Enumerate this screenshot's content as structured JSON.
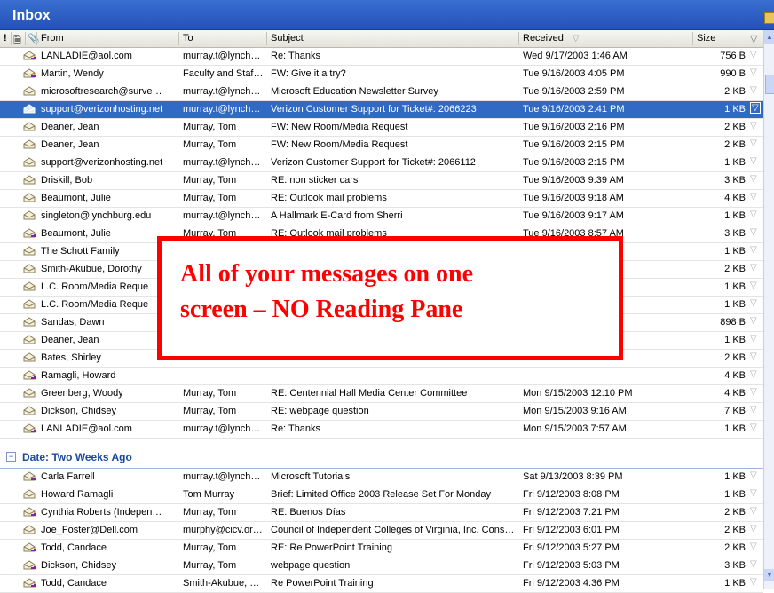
{
  "window": {
    "title": "Inbox"
  },
  "columns": {
    "from": "From",
    "to": "To",
    "subject": "Subject",
    "received": "Received",
    "size": "Size"
  },
  "rows": [
    {
      "from": "LANLADIE@aol.com",
      "to": "murray.t@lynch…",
      "subject": "Re: Thanks",
      "received": "Wed 9/17/2003 1:46 AM",
      "size": "756 B",
      "icon": "envelope-reply-icon"
    },
    {
      "from": "Martin, Wendy",
      "to": "Faculty and Staf…",
      "subject": "FW: Give it a try?",
      "received": "Tue 9/16/2003 4:05 PM",
      "size": "990 B",
      "icon": "envelope-reply-icon"
    },
    {
      "from": "microsoftresearch@surve…",
      "to": "murray.t@lynch…",
      "subject": "Microsoft Education Newsletter Survey",
      "received": "Tue 9/16/2003 2:59 PM",
      "size": "2 KB",
      "icon": "envelope-open-icon"
    },
    {
      "from": "support@verizonhosting.net",
      "to": "murray.t@lynch…",
      "subject": "Verizon Customer Support for Ticket#: 2066223",
      "received": "Tue 9/16/2003 2:41 PM",
      "size": "1 KB",
      "icon": "envelope-open-icon",
      "selected": true
    },
    {
      "from": "Deaner, Jean",
      "to": "Murray, Tom",
      "subject": "FW: New Room/Media Request",
      "received": "Tue 9/16/2003 2:16 PM",
      "size": "2 KB",
      "icon": "envelope-open-icon"
    },
    {
      "from": "Deaner, Jean",
      "to": "Murray, Tom",
      "subject": "FW: New Room/Media Request",
      "received": "Tue 9/16/2003 2:15 PM",
      "size": "2 KB",
      "icon": "envelope-open-icon"
    },
    {
      "from": "support@verizonhosting.net",
      "to": "murray.t@lynch…",
      "subject": "Verizon Customer Support for Ticket#: 2066112",
      "received": "Tue 9/16/2003 2:15 PM",
      "size": "1 KB",
      "icon": "envelope-open-icon"
    },
    {
      "from": "Driskill, Bob",
      "to": "Murray, Tom",
      "subject": "RE: non sticker cars",
      "received": "Tue 9/16/2003 9:39 AM",
      "size": "3 KB",
      "icon": "envelope-open-icon"
    },
    {
      "from": "Beaumont, Julie",
      "to": "Murray, Tom",
      "subject": "RE: Outlook mail problems",
      "received": "Tue 9/16/2003 9:18 AM",
      "size": "4 KB",
      "icon": "envelope-open-icon"
    },
    {
      "from": "singleton@lynchburg.edu",
      "to": "murray.t@lynch…",
      "subject": "A Hallmark E-Card from Sherri",
      "received": "Tue 9/16/2003 9:17 AM",
      "size": "1 KB",
      "icon": "envelope-open-icon"
    },
    {
      "from": "Beaumont, Julie",
      "to": "Murray, Tom",
      "subject": "RE: Outlook mail problems",
      "received": "Tue 9/16/2003 8:57 AM",
      "size": "3 KB",
      "icon": "envelope-reply-icon"
    },
    {
      "from": "The Schott Family",
      "to": "",
      "subject": "",
      "received": "",
      "size": "1 KB",
      "icon": "envelope-open-icon"
    },
    {
      "from": "Smith-Akubue, Dorothy",
      "to": "",
      "subject": "",
      "received": "",
      "size": "2 KB",
      "icon": "envelope-open-icon"
    },
    {
      "from": "L.C. Room/Media Reque",
      "to": "",
      "subject": "",
      "received": "",
      "size": "1 KB",
      "icon": "envelope-open-icon"
    },
    {
      "from": "L.C. Room/Media Reque",
      "to": "",
      "subject": "",
      "received": "",
      "size": "1 KB",
      "icon": "envelope-open-icon"
    },
    {
      "from": "Sandas, Dawn",
      "to": "",
      "subject": "",
      "received": "",
      "size": "898 B",
      "icon": "envelope-open-icon"
    },
    {
      "from": "Deaner, Jean",
      "to": "",
      "subject": "",
      "received": "",
      "size": "1 KB",
      "icon": "envelope-open-icon"
    },
    {
      "from": "Bates, Shirley",
      "to": "",
      "subject": "",
      "received": "",
      "size": "2 KB",
      "icon": "envelope-open-icon"
    },
    {
      "from": "Ramagli, Howard",
      "to": "",
      "subject": "",
      "received": "",
      "size": "4 KB",
      "icon": "envelope-reply-icon"
    },
    {
      "from": "Greenberg, Woody",
      "to": "Murray, Tom",
      "subject": "RE: Centennial Hall Media Center Committee",
      "received": "Mon 9/15/2003 12:10 PM",
      "size": "4 KB",
      "icon": "envelope-open-icon"
    },
    {
      "from": "Dickson, Chidsey",
      "to": "Murray, Tom",
      "subject": "RE: webpage question",
      "received": "Mon 9/15/2003 9:16 AM",
      "size": "7 KB",
      "icon": "envelope-open-icon"
    },
    {
      "from": "LANLADIE@aol.com",
      "to": "murray.t@lynch…",
      "subject": "Re: Thanks",
      "received": "Mon 9/15/2003 7:57 AM",
      "size": "1 KB",
      "icon": "envelope-reply-icon"
    }
  ],
  "group2": {
    "label": "Date: Two Weeks Ago"
  },
  "rows2": [
    {
      "from": "Carla Farrell",
      "to": "murray.t@lynch…",
      "subject": "Microsoft Tutorials",
      "received": "Sat 9/13/2003 8:39 PM",
      "size": "1 KB",
      "icon": "envelope-reply-icon"
    },
    {
      "from": "Howard Ramagli",
      "to": "Tom Murray",
      "subject": "Brief: Limited Office 2003 Release Set For Monday",
      "received": "Fri 9/12/2003 8:08 PM",
      "size": "1 KB",
      "icon": "envelope-open-icon"
    },
    {
      "from": "Cynthia Roberts (Indepen…",
      "to": "Murray, Tom",
      "subject": "RE: Buenos Días",
      "received": "Fri 9/12/2003 7:21 PM",
      "size": "2 KB",
      "icon": "envelope-reply-icon"
    },
    {
      "from": "Joe_Foster@Dell.com",
      "to": "murphy@cicv.or…",
      "subject": "Council of Independent Colleges of Virginia, Inc. Cons…",
      "received": "Fri 9/12/2003 6:01 PM",
      "size": "2 KB",
      "icon": "envelope-open-icon"
    },
    {
      "from": "Todd, Candace",
      "to": "Murray, Tom",
      "subject": "RE: Re PowerPoint Training",
      "received": "Fri 9/12/2003 5:27 PM",
      "size": "2 KB",
      "icon": "envelope-reply-icon"
    },
    {
      "from": "Dickson, Chidsey",
      "to": "Murray, Tom",
      "subject": "webpage question",
      "received": "Fri 9/12/2003 5:03 PM",
      "size": "3 KB",
      "icon": "envelope-reply-icon"
    },
    {
      "from": "Todd, Candace",
      "to": "Smith-Akubue, D…",
      "subject": "Re PowerPoint Training",
      "received": "Fri 9/12/2003 4:36 PM",
      "size": "1 KB",
      "icon": "envelope-reply-icon"
    }
  ],
  "callout": {
    "line1": "All of your messages on one",
    "line2": "screen – NO Reading Pane",
    "color": "#ff0000"
  },
  "colors": {
    "titlebar": "#2a56bd",
    "selected": "#316ac5",
    "group": "#1a4aa0"
  }
}
